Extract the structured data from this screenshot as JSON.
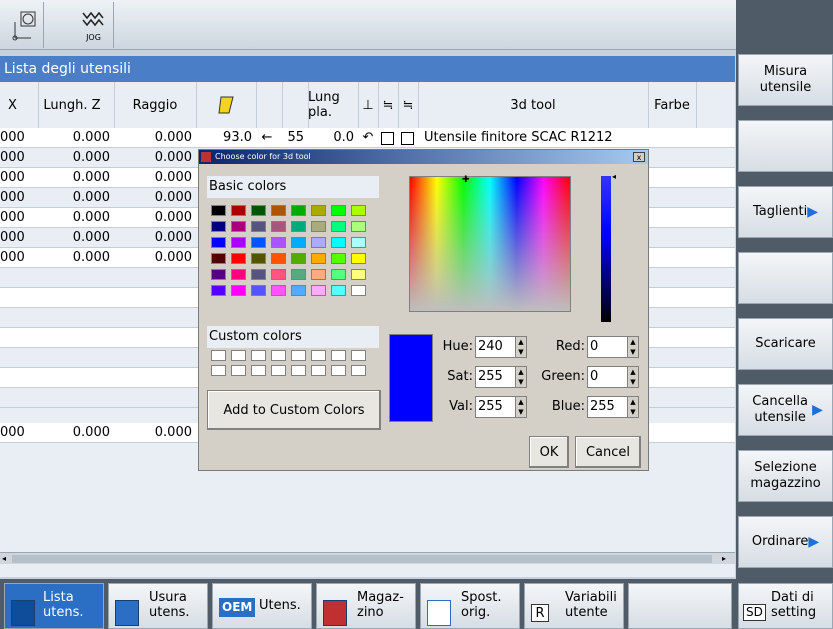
{
  "top": {
    "jog_label": "JOG"
  },
  "title": "Lista degli utensili",
  "headers": {
    "x": "X",
    "lungh_z": "Lungh. Z",
    "raggio": "Raggio",
    "lung_pla": "Lung pla.",
    "tool3d": "3d tool",
    "farbe": "Farbe"
  },
  "rows": [
    {
      "x": "000",
      "z": "0.000",
      "r": "0.000",
      "angle": "93.0",
      "dir": "←",
      "val": "55",
      "lp": "0.0",
      "name": "Utensile finitore SCAC R1212"
    },
    {
      "x": "000",
      "z": "0.000",
      "r": "0.000"
    },
    {
      "x": "000",
      "z": "0.000",
      "r": "0.000"
    },
    {
      "x": "000",
      "z": "0.000",
      "r": "0.000"
    },
    {
      "x": "000",
      "z": "0.000",
      "r": "0.000"
    },
    {
      "x": "000",
      "z": "0.000",
      "r": "0.000"
    },
    {
      "x": "000",
      "z": "0.000",
      "r": "0.000"
    },
    {
      "x": "000",
      "z": "0.000",
      "r": "0.000"
    }
  ],
  "dialog": {
    "title": "Choose color for 3d tool",
    "basic_colors": "Basic colors",
    "custom_colors": "Custom colors",
    "add_custom": "Add to Custom Colors",
    "hue_label": "Hue:",
    "hue": "240",
    "sat_label": "Sat:",
    "sat": "255",
    "val_label": "Val:",
    "val": "255",
    "red_label": "Red:",
    "red": "0",
    "green_label": "Green:",
    "green": "0",
    "blue_label": "Blue:",
    "blue": "255",
    "ok": "OK",
    "cancel": "Cancel",
    "current_color": "#0000ff",
    "swatches": [
      "#000000",
      "#aa0000",
      "#005500",
      "#aa5500",
      "#00aa00",
      "#aaaa00",
      "#00ff00",
      "#aaff00",
      "#00007f",
      "#aa007f",
      "#55557f",
      "#aa557f",
      "#00aa7f",
      "#aaaa7f",
      "#00ff7f",
      "#aaff7f",
      "#0000ff",
      "#aa00ff",
      "#0055ff",
      "#aa55ff",
      "#00aaff",
      "#aaaaff",
      "#00ffff",
      "#aaffff",
      "#550000",
      "#ff0000",
      "#555500",
      "#ff5500",
      "#55aa00",
      "#ffaa00",
      "#55ff00",
      "#ffff00",
      "#55007f",
      "#ff007f",
      "#55557f",
      "#ff557f",
      "#55aa7f",
      "#ffaa7f",
      "#55ff7f",
      "#ffff7f",
      "#5500ff",
      "#ff00ff",
      "#5555ff",
      "#ff55ff",
      "#55aaff",
      "#ffaaff",
      "#55ffff",
      "#ffffff"
    ]
  },
  "softkeys_right": [
    {
      "label": "Misura utensile"
    },
    {
      "label": ""
    },
    {
      "label": "Taglienti",
      "arrow": true
    },
    {
      "label": ""
    },
    {
      "label": "Scaricare"
    },
    {
      "label": "Cancella utensile",
      "arrow": true
    },
    {
      "label": "Selezione magazzino"
    },
    {
      "label": "Ordinare",
      "arrow": true
    }
  ],
  "softkeys_bottom": [
    {
      "label": "Lista utens.",
      "selected": true
    },
    {
      "label": "Usura utens."
    },
    {
      "label": "Utens.",
      "badge": "OEM"
    },
    {
      "label": "Magaz- zino"
    },
    {
      "label": "Spost. orig."
    },
    {
      "label": "Variabili utente",
      "badge": "R"
    },
    {
      "label": ""
    },
    {
      "label": "Dati di setting",
      "badge": "SD"
    }
  ],
  "colors": {
    "accent": "#4a7ec7",
    "selected_key": "#2a6fc4",
    "arrow": "#1e6fd8"
  }
}
